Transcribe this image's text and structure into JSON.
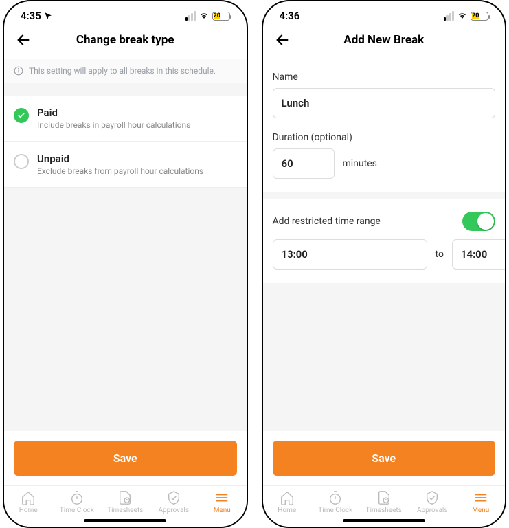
{
  "left": {
    "statusTime": "4:35",
    "battery": "20",
    "title": "Change break type",
    "infoText": "This setting will apply to all breaks in this schedule.",
    "options": [
      {
        "label": "Paid",
        "desc": "Include breaks in payroll hour calculations",
        "selected": true
      },
      {
        "label": "Unpaid",
        "desc": "Exclude breaks from payroll hour calculations",
        "selected": false
      }
    ],
    "saveLabel": "Save"
  },
  "right": {
    "statusTime": "4:36",
    "battery": "20",
    "title": "Add New Break",
    "nameLabel": "Name",
    "nameValue": "Lunch",
    "durationLabel": "Duration (optional)",
    "durationValue": "60",
    "durationUnit": "minutes",
    "restrictedLabel": "Add restricted time range",
    "timeFrom": "13:00",
    "timeTo": "14:00",
    "toLabel": "to",
    "saveLabel": "Save"
  },
  "tabs": [
    {
      "label": "Home"
    },
    {
      "label": "Time Clock"
    },
    {
      "label": "Timesheets"
    },
    {
      "label": "Approvals"
    },
    {
      "label": "Menu"
    }
  ]
}
